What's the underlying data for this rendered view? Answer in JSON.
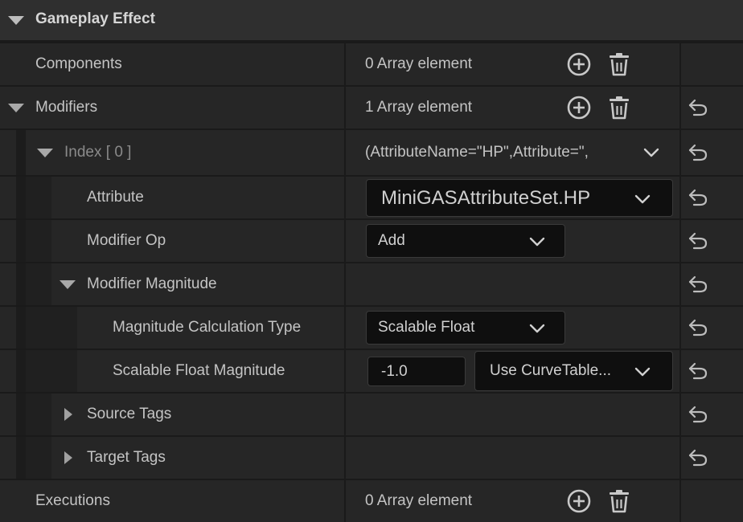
{
  "category": {
    "title": "Gameplay Effect"
  },
  "rows": {
    "components": {
      "label": "Components",
      "value": "0 Array element"
    },
    "modifiers": {
      "label": "Modifiers",
      "value": "1 Array element"
    },
    "index0": {
      "label": "Index",
      "index": "[ 0 ]",
      "value": "(AttributeName=\"HP\",Attribute=\","
    },
    "attribute": {
      "label": "Attribute",
      "value": "MiniGASAttributeSet.HP"
    },
    "modifier_op": {
      "label": "Modifier Op",
      "value": "Add"
    },
    "modifier_magnitude": {
      "label": "Modifier Magnitude"
    },
    "magnitude_calc_type": {
      "label": "Magnitude Calculation Type",
      "value": "Scalable Float"
    },
    "scalable_float_magnitude": {
      "label": "Scalable Float Magnitude",
      "value": "-1.0",
      "curve": "Use CurveTable..."
    },
    "source_tags": {
      "label": "Source Tags"
    },
    "target_tags": {
      "label": "Target Tags"
    },
    "executions": {
      "label": "Executions",
      "value": "0 Array element"
    }
  },
  "icons": {
    "add": "add-element-icon",
    "delete": "delete-icon",
    "reset": "reset-to-default-icon",
    "dropdown": "chevron-down-icon",
    "expanded": "triangle-down-icon",
    "collapsed": "triangle-right-icon"
  },
  "colors": {
    "background": "#1a1a1a",
    "row": "#262626",
    "header": "#2f2f2f",
    "field": "#0f0f0f",
    "text": "#c4c4c4",
    "muted_text": "#8a8a8a"
  }
}
